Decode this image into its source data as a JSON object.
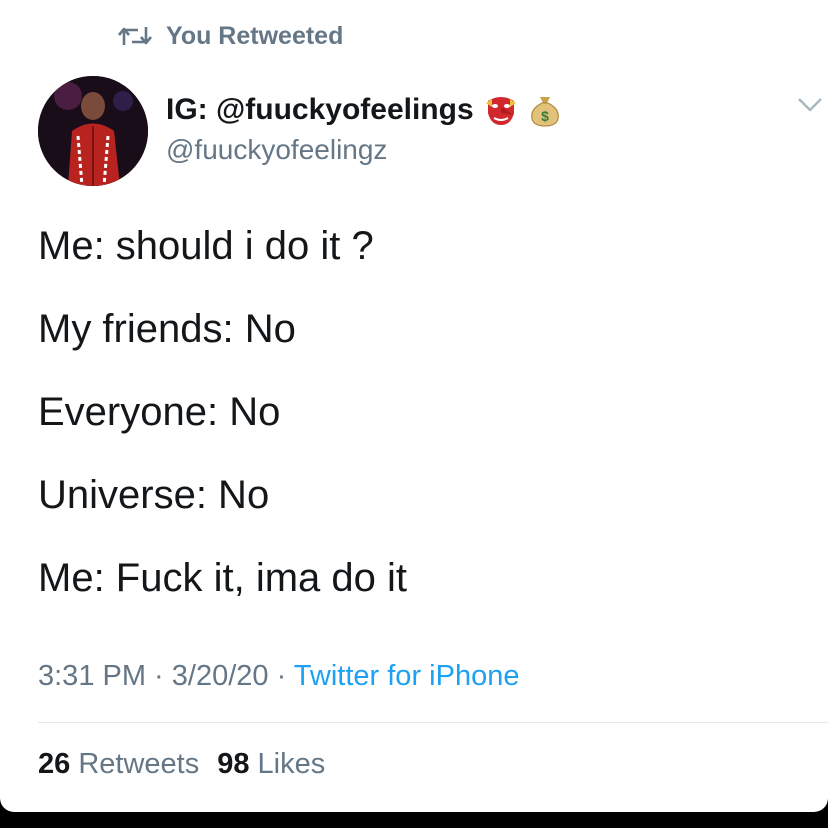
{
  "retweet_banner": {
    "text": "You Retweeted",
    "icon": "retweet-icon"
  },
  "author": {
    "display_name": "IG: @fuuckyofeelings",
    "handle": "@fuuckyofeelingz",
    "name_emojis": [
      "goblin-mask-emoji",
      "money-bag-emoji"
    ],
    "avatar": "profile-photo"
  },
  "menu_icon": "chevron-down-icon",
  "tweet": {
    "lines": [
      "Me: should i do it ?",
      "My friends: No",
      "Everyone: No",
      "Universe: No",
      "Me: Fuck it, ima do it"
    ]
  },
  "meta": {
    "time": "3:31 PM",
    "sep1": " · ",
    "date": "3/20/20",
    "sep2": " · ",
    "source": "Twitter for iPhone"
  },
  "stats": {
    "retweets_count": "26",
    "retweets_label": "Retweets",
    "likes_count": "98",
    "likes_label": "Likes"
  },
  "colors": {
    "text": "#14171a",
    "secondary": "#657786",
    "link": "#1da1f2",
    "divider": "#e1e8ed"
  }
}
